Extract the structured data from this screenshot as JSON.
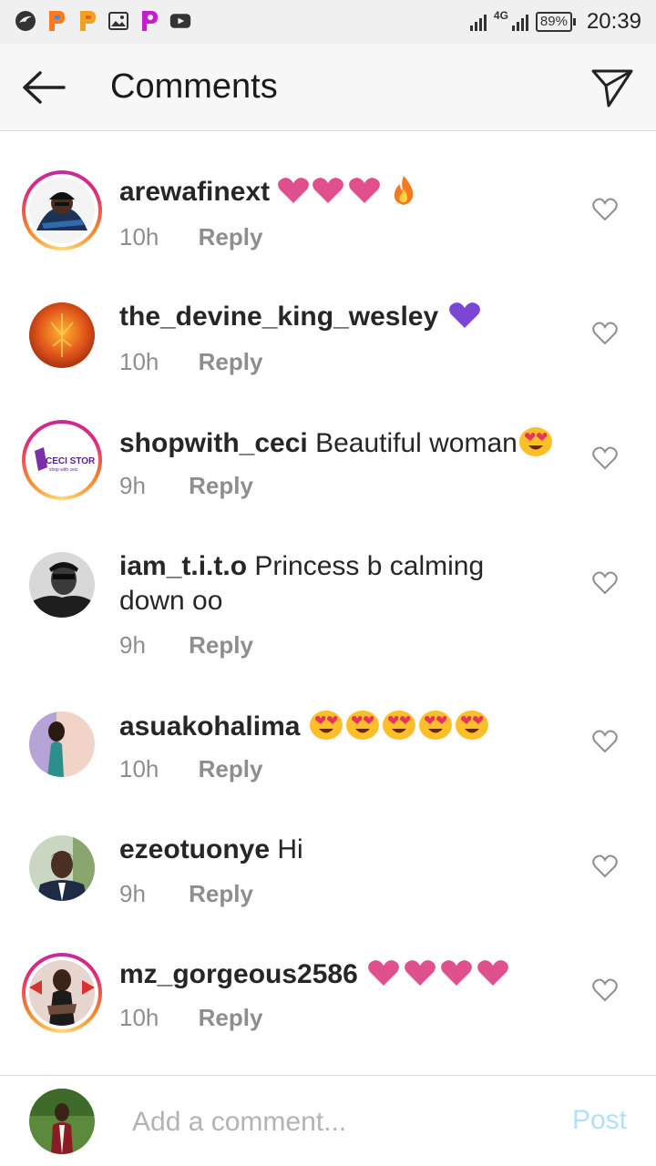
{
  "status_bar": {
    "network": "4G",
    "battery": "89%",
    "time": "20:39"
  },
  "header": {
    "title": "Comments"
  },
  "comments": [
    {
      "username": "arewafinext",
      "text": "",
      "emoji": "pink-heart pink-heart pink-heart fire",
      "time": "10h",
      "reply": "Reply"
    },
    {
      "username": "the_devine_king_wesley",
      "text": "",
      "emoji": "purple-heart",
      "time": "10h",
      "reply": "Reply"
    },
    {
      "username": "shopwith_ceci",
      "text": "Beautiful woman",
      "emoji": "heart-eyes-face",
      "time": "9h",
      "reply": "Reply"
    },
    {
      "username": "iam_t.i.t.o",
      "text": "Princess b calming down oo",
      "emoji": "",
      "time": "9h",
      "reply": "Reply"
    },
    {
      "username": "asuakohalima",
      "text": "",
      "emoji": "heart-eyes-face x5",
      "time": "10h",
      "reply": "Reply"
    },
    {
      "username": "ezeotuonye",
      "text": "Hi",
      "emoji": "",
      "time": "9h",
      "reply": "Reply"
    },
    {
      "username": "mz_gorgeous2586",
      "text": "",
      "emoji": "pink-heart x4",
      "time": "10h",
      "reply": "Reply"
    }
  ],
  "avatar_labels": {
    "shop_logo": "CECI STORE",
    "shop_tagline": "shop with ceci"
  },
  "footer": {
    "placeholder": "Add a comment...",
    "post_label": "Post"
  },
  "colors": {
    "post_disabled": "#b2dffc",
    "meta_gray": "#8e8e8e",
    "heart_pink": "#e0508e",
    "heart_purple": "#7b45d6"
  }
}
